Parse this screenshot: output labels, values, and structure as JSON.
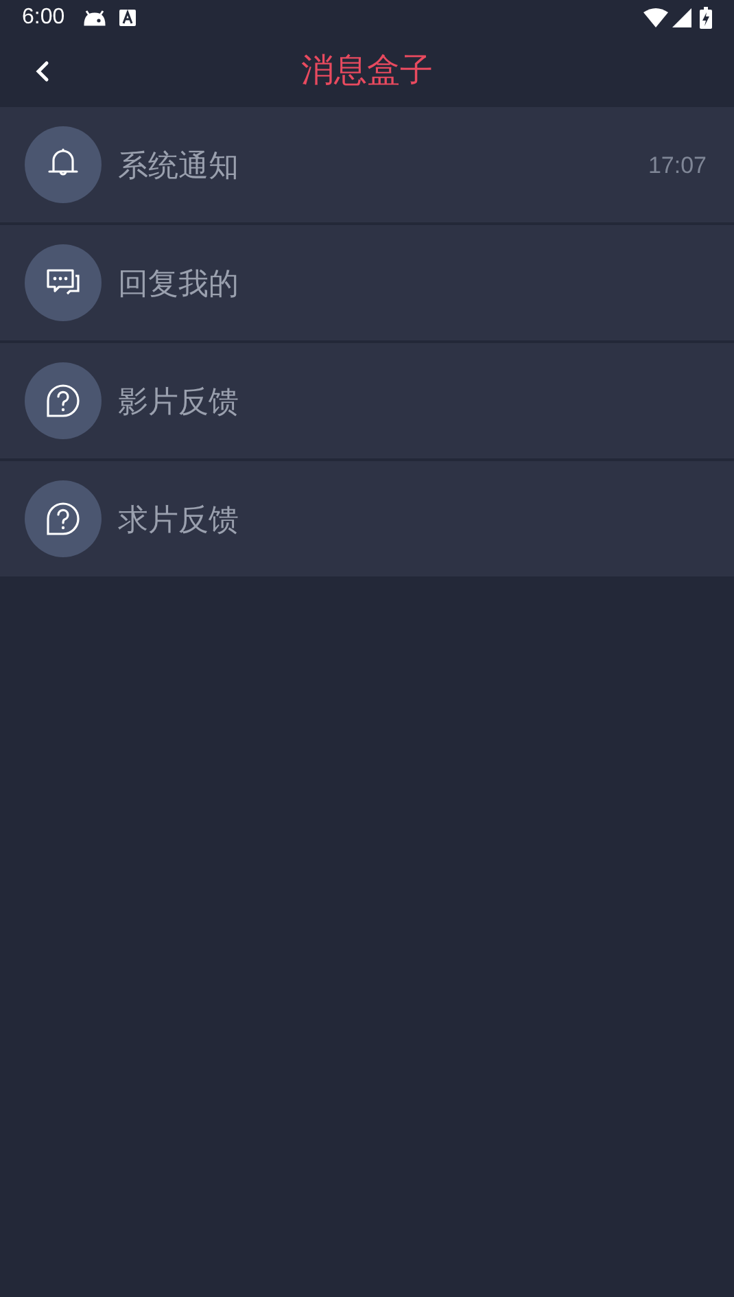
{
  "status_bar": {
    "time": "6:00"
  },
  "header": {
    "title": "消息盒子"
  },
  "items": [
    {
      "kind": "bell",
      "label": "系统通知",
      "time": "17:07"
    },
    {
      "kind": "chat",
      "label": "回复我的"
    },
    {
      "kind": "question",
      "label": "影片反馈"
    },
    {
      "kind": "question",
      "label": "求片反馈"
    }
  ]
}
